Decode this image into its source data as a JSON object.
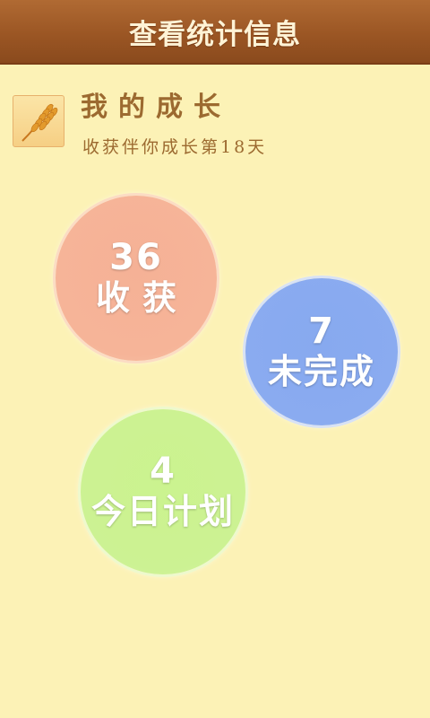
{
  "header": {
    "title": "查看统计信息"
  },
  "profile": {
    "avatar_icon": "wheat-icon",
    "name": "我的成长",
    "subtitle": "收获伴你成长第18天"
  },
  "stats": {
    "harvest": {
      "count": "36",
      "label": "收获",
      "color": "#f6b498"
    },
    "incomplete": {
      "count": "7",
      "label": "未完成",
      "color": "#8aabf0"
    },
    "today_plan": {
      "count": "4",
      "label": "今日计划",
      "color": "#ccf293"
    }
  }
}
